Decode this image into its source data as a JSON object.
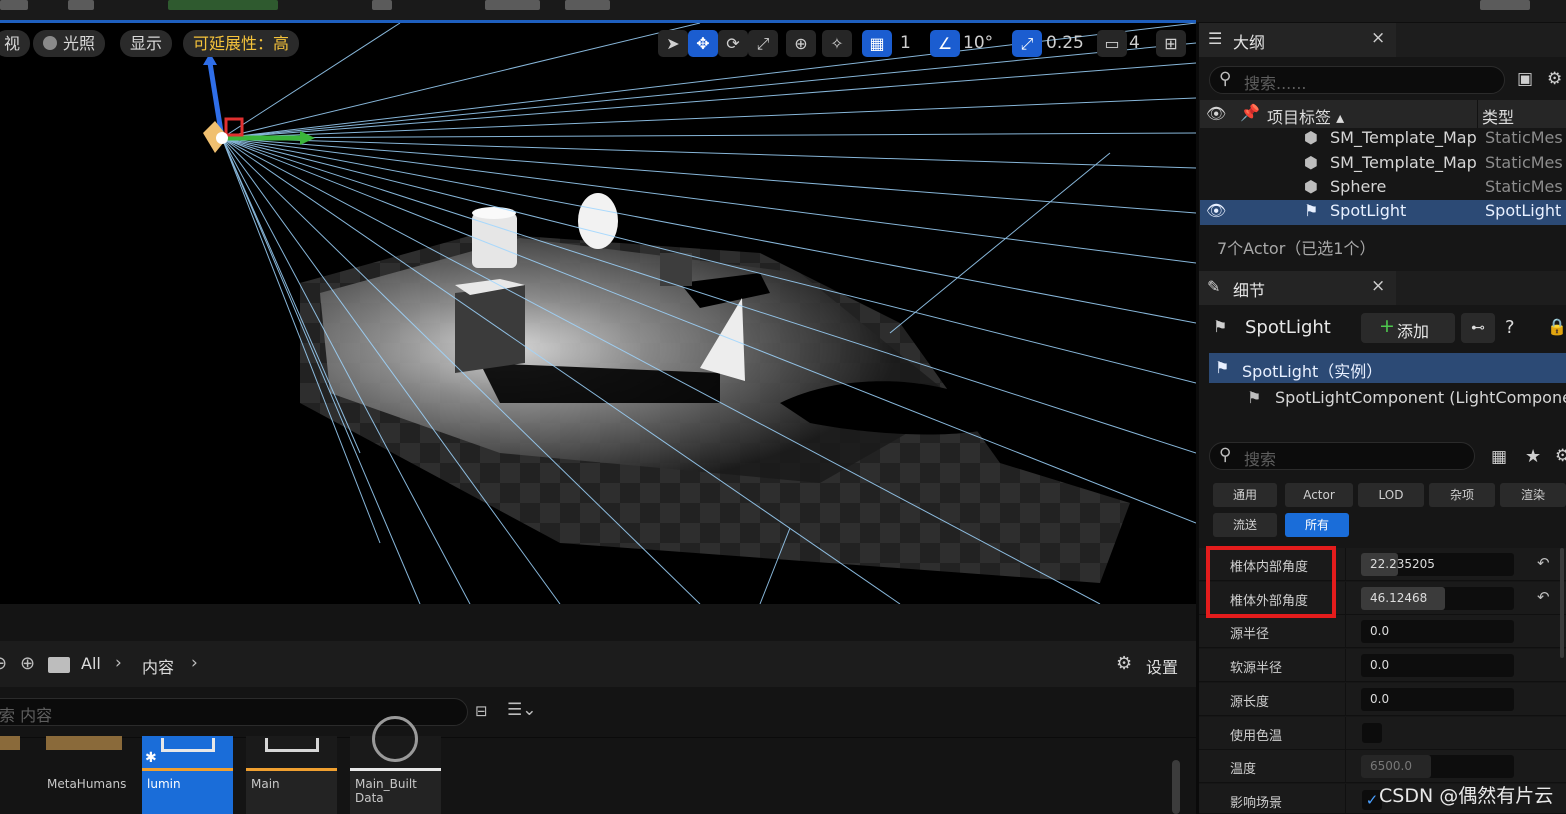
{
  "viewport": {
    "mode_label": "视",
    "lighting_label": "光照",
    "show_label": "显示",
    "scalability_label": "可延展性：高",
    "grid_snap_value": "1",
    "rotate_snap_value": "10°",
    "scale_snap_value": "0.25",
    "camera_speed_value": "4"
  },
  "outliner": {
    "tab_title": "大纲",
    "close": "×",
    "search_placeholder": "搜索......",
    "col_label": "项目标签 ▴",
    "col_type": "类型",
    "rows": [
      {
        "name": "SM_Template_Map",
        "type": "StaticMes"
      },
      {
        "name": "SM_Template_Map",
        "type": "StaticMes"
      },
      {
        "name": "Sphere",
        "type": "StaticMes"
      },
      {
        "name": "SpotLight",
        "type": "SpotLight"
      }
    ],
    "status": "7个Actor（已选1个）"
  },
  "details": {
    "tab_title": "细节",
    "close": "×",
    "actor_name": "SpotLight",
    "add_button": "添加",
    "instance_label": "SpotLight（实例）",
    "component_label": "SpotLightComponent (LightCompone",
    "search_placeholder": "搜索",
    "filters": [
      "通用",
      "Actor",
      "LOD",
      "杂项",
      "渲染",
      "流送",
      "所有"
    ],
    "properties": [
      {
        "label": "椎体内部角度",
        "value": "22.235205",
        "fill": 0.24
      },
      {
        "label": "椎体外部角度",
        "value": "46.12468",
        "fill": 0.55
      },
      {
        "label": "源半径",
        "value": "0.0"
      },
      {
        "label": "软源半径",
        "value": "0.0"
      },
      {
        "label": "源长度",
        "value": "0.0"
      },
      {
        "label": "使用色温",
        "value": ""
      },
      {
        "label": "温度",
        "value": "6500.0",
        "fill": 0.46
      },
      {
        "label": "影响场景",
        "value": "✓"
      }
    ]
  },
  "content_browser": {
    "path_all": "All",
    "path_content": "内容",
    "settings_label": "设置",
    "search_placeholder": "索 内容",
    "tiles": [
      {
        "name": "MetaHumans"
      },
      {
        "name": "lumin"
      },
      {
        "name": "Main"
      },
      {
        "name": "Main_Built Data"
      }
    ]
  },
  "watermark": "CSDN @偶然有片云",
  "colors": {
    "accent": "#1a6dd9",
    "selection": "#2c4a75",
    "highlight": "#e41c1c",
    "warning": "#f5c33b"
  }
}
